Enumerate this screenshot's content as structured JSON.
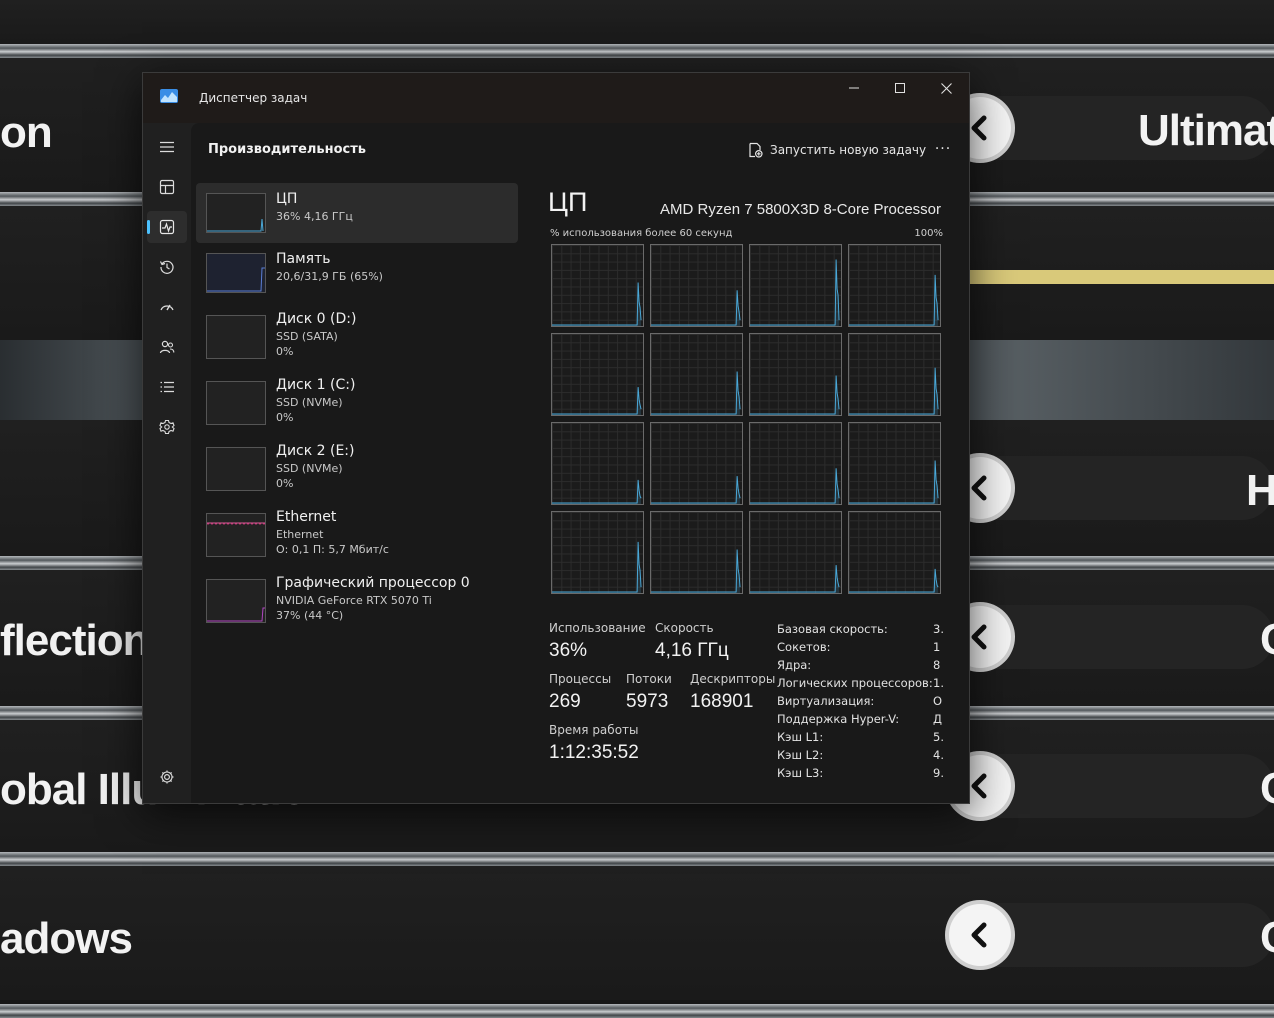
{
  "background": {
    "labels": [
      "on",
      "flections",
      "obal Illumination",
      "adows"
    ],
    "values": [
      "Ultimat",
      "H",
      "C",
      "C",
      "C"
    ],
    "accent_bar_color": "#d9c97a"
  },
  "window": {
    "title": "Диспетчер задач",
    "controls": {
      "minimize": "minimize-icon",
      "maximize": "maximize-icon",
      "close": "close-icon"
    }
  },
  "nav": {
    "items": [
      {
        "icon": "hamburger-icon"
      },
      {
        "icon": "processes-icon"
      },
      {
        "icon": "performance-icon",
        "active": true
      },
      {
        "icon": "app-history-icon"
      },
      {
        "icon": "startup-apps-icon"
      },
      {
        "icon": "users-icon"
      },
      {
        "icon": "details-icon"
      },
      {
        "icon": "services-icon"
      }
    ],
    "settings_icon": "settings-icon"
  },
  "header": {
    "title": "Производительность",
    "run_task": "Запустить новую задачу",
    "more": "···"
  },
  "devices": [
    {
      "name": "ЦП",
      "sub1": "36% 4,16 ГГц",
      "sub2": "",
      "selected": true,
      "thumb_color": "#4aa8d8",
      "usage": 0.36
    },
    {
      "name": "Память",
      "sub1": "20,6/31,9 ГБ (65%)",
      "sub2": "",
      "thumb_color": "#5b7fd6",
      "usage": 0.65
    },
    {
      "name": "Диск 0 (D:)",
      "sub1": "SSD (SATA)",
      "sub2": "0%",
      "thumb_color": "#7fba00",
      "usage": 0
    },
    {
      "name": "Диск 1 (C:)",
      "sub1": "SSD (NVMe)",
      "sub2": "0%",
      "thumb_color": "#7fba00",
      "usage": 0
    },
    {
      "name": "Диск 2 (E:)",
      "sub1": "SSD (NVMe)",
      "sub2": "0%",
      "thumb_color": "#7fba00",
      "usage": 0
    },
    {
      "name": "Ethernet",
      "sub1": "Ethernet",
      "sub2": "О: 0,1 П: 5,7 Мбит/с",
      "thumb_color": "#e05a9a",
      "usage": 0.05
    },
    {
      "name": "Графический процессор 0",
      "sub1": "NVIDIA GeForce RTX 5070 Ti",
      "sub2": "37% (44 °C)",
      "thumb_color": "#b146c2",
      "usage": 0.37
    }
  ],
  "cpu": {
    "title": "ЦП",
    "model": "AMD Ryzen 7 5800X3D 8-Core Processor",
    "graph_label": "% использования более 60 секунд",
    "graph_max": "100%",
    "line_color": "#4aa8d8",
    "core_peaks": [
      0.55,
      0.45,
      0.85,
      0.65,
      0.35,
      0.55,
      0.5,
      0.6,
      0.3,
      0.35,
      0.45,
      0.55,
      0.65,
      0.55,
      0.35,
      0.3
    ],
    "stats": {
      "usage_label": "Использование",
      "usage": "36%",
      "speed_label": "Скорость",
      "speed": "4,16 ГГц",
      "processes_label": "Процессы",
      "processes": "269",
      "threads_label": "Потоки",
      "threads": "5973",
      "handles_label": "Дескрипторы",
      "handles": "168901",
      "uptime_label": "Время работы",
      "uptime": "1:12:35:52"
    },
    "specs": [
      {
        "label": "Базовая скорость:",
        "value": "3."
      },
      {
        "label": "Сокетов:",
        "value": "1"
      },
      {
        "label": "Ядра:",
        "value": "8"
      },
      {
        "label": "Логических процессоров:",
        "value": "1."
      },
      {
        "label": "Виртуализация:",
        "value": "О"
      },
      {
        "label": "Поддержка Hyper-V:",
        "value": "Д"
      },
      {
        "label": "Кэш L1:",
        "value": "5."
      },
      {
        "label": "Кэш L2:",
        "value": "4."
      },
      {
        "label": "Кэш L3:",
        "value": "9."
      }
    ]
  }
}
